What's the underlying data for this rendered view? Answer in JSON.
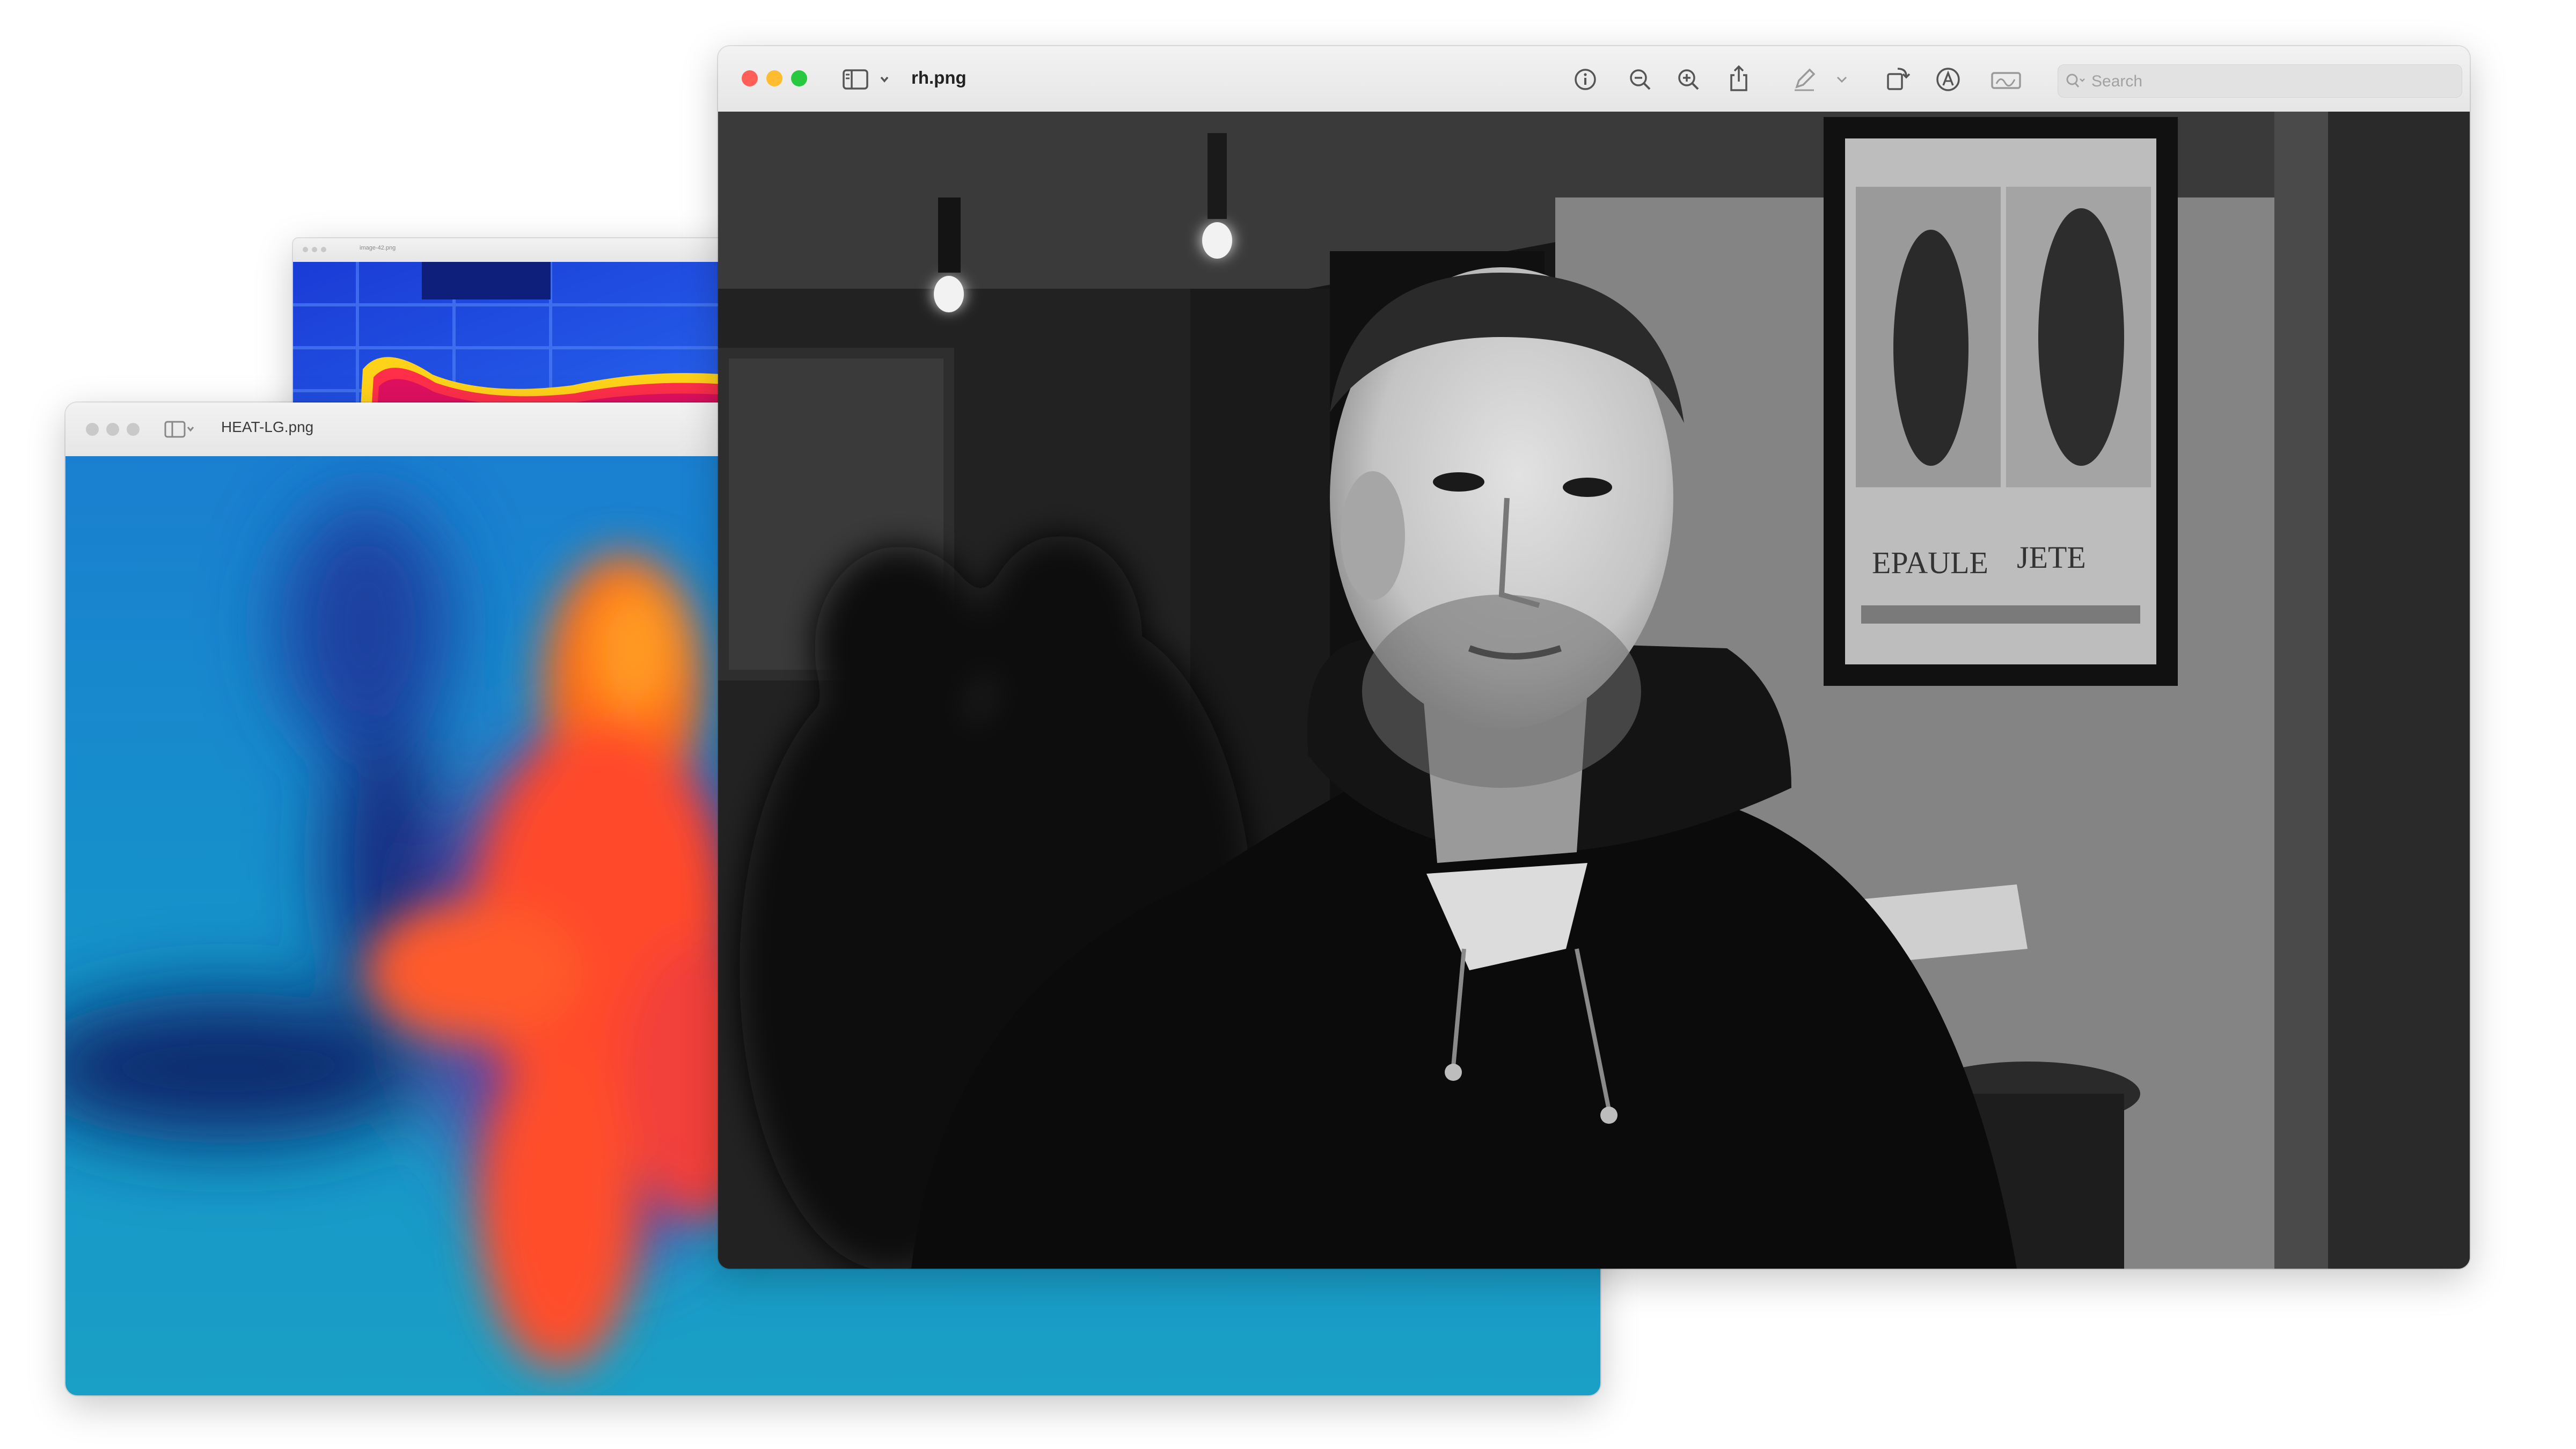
{
  "windows": {
    "back": {
      "title": "image-42.png"
    },
    "heat": {
      "title": "HEAT-LG.png"
    },
    "front": {
      "title": "rh.png",
      "toolbar": {
        "info": "info-icon",
        "zoom_out": "zoom-out-icon",
        "zoom_in": "zoom-in-icon",
        "share": "share-icon",
        "markup": "markup-pen-icon",
        "markup_menu": "chevron-down-icon",
        "rotate": "rotate-icon",
        "annotate": "annotate-icon",
        "sign": "signature-icon"
      },
      "search": {
        "placeholder": "Search"
      }
    }
  },
  "photo": {
    "poster_text_left": "EPAULE",
    "poster_text_right": "JETE"
  },
  "colors": {
    "close": "#ff5f57",
    "minimize": "#febc2e",
    "zoom": "#28c840",
    "inactive_light": "#c9c9c9"
  }
}
